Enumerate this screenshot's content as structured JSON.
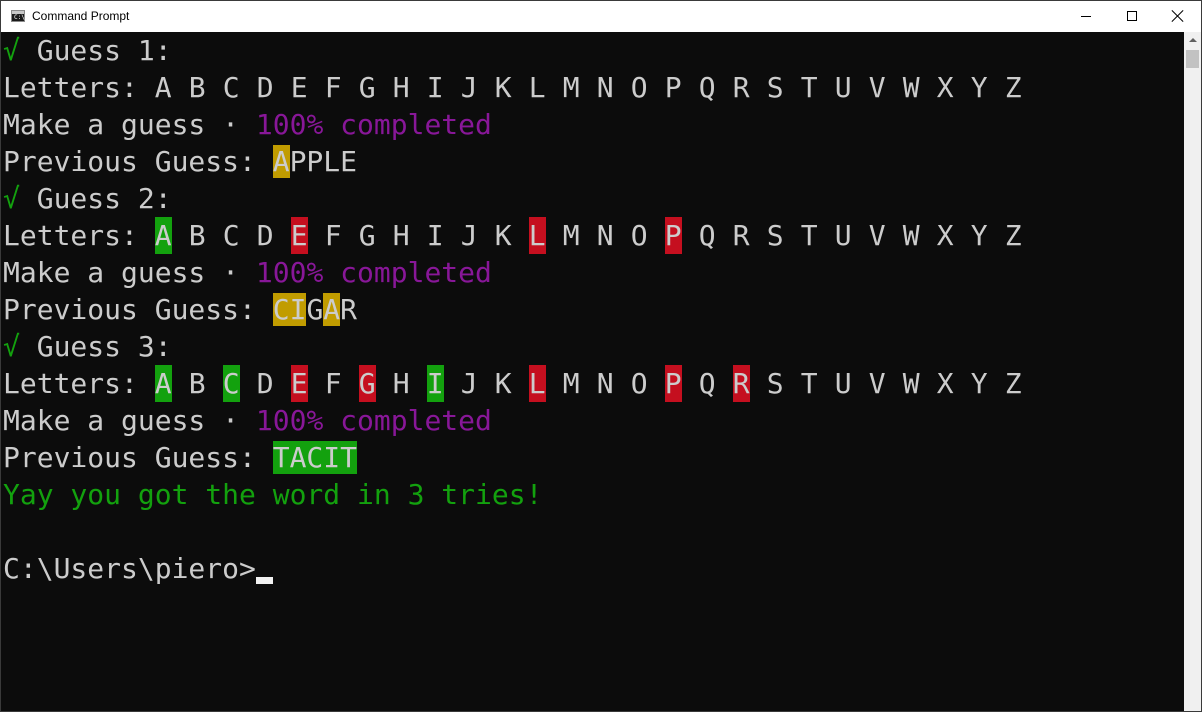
{
  "window": {
    "title": "Command Prompt",
    "app_icon_text": "C:\\"
  },
  "console": {
    "lines": [
      [
        {
          "t": "√",
          "c": "g"
        },
        {
          "t": " Guess 1:"
        }
      ],
      [
        {
          "t": "Letters: "
        },
        {
          "letters": [
            {
              "t": "A"
            },
            {
              "t": "B"
            },
            {
              "t": "C"
            },
            {
              "t": "D"
            },
            {
              "t": "E"
            },
            {
              "t": "F"
            },
            {
              "t": "G"
            },
            {
              "t": "H"
            },
            {
              "t": "I"
            },
            {
              "t": "J"
            },
            {
              "t": "K"
            },
            {
              "t": "L"
            },
            {
              "t": "M"
            },
            {
              "t": "N"
            },
            {
              "t": "O"
            },
            {
              "t": "P"
            },
            {
              "t": "Q"
            },
            {
              "t": "R"
            },
            {
              "t": "S"
            },
            {
              "t": "T"
            },
            {
              "t": "U"
            },
            {
              "t": "V"
            },
            {
              "t": "W"
            },
            {
              "t": "X"
            },
            {
              "t": "Y"
            },
            {
              "t": "Z"
            }
          ]
        }
      ],
      [
        {
          "t": "Make a guess · "
        },
        {
          "t": "100% completed",
          "c": "p"
        }
      ],
      [
        {
          "t": "Previous Guess: "
        },
        {
          "t": "A",
          "bg": "yellow"
        },
        {
          "t": "PPLE"
        }
      ],
      [
        {
          "t": "√",
          "c": "g"
        },
        {
          "t": " Guess 2:"
        }
      ],
      [
        {
          "t": "Letters: "
        },
        {
          "letters": [
            {
              "t": "A",
              "bg": "green"
            },
            {
              "t": "B"
            },
            {
              "t": "C"
            },
            {
              "t": "D"
            },
            {
              "t": "E",
              "bg": "red"
            },
            {
              "t": "F"
            },
            {
              "t": "G"
            },
            {
              "t": "H"
            },
            {
              "t": "I"
            },
            {
              "t": "J"
            },
            {
              "t": "K"
            },
            {
              "t": "L",
              "bg": "red"
            },
            {
              "t": "M"
            },
            {
              "t": "N"
            },
            {
              "t": "O"
            },
            {
              "t": "P",
              "bg": "red"
            },
            {
              "t": "Q"
            },
            {
              "t": "R"
            },
            {
              "t": "S"
            },
            {
              "t": "T"
            },
            {
              "t": "U"
            },
            {
              "t": "V"
            },
            {
              "t": "W"
            },
            {
              "t": "X"
            },
            {
              "t": "Y"
            },
            {
              "t": "Z"
            }
          ]
        }
      ],
      [
        {
          "t": "Make a guess · "
        },
        {
          "t": "100% completed",
          "c": "p"
        }
      ],
      [
        {
          "t": "Previous Guess: "
        },
        {
          "t": "CI",
          "bg": "yellow"
        },
        {
          "t": "G"
        },
        {
          "t": "A",
          "bg": "yellow"
        },
        {
          "t": "R"
        }
      ],
      [
        {
          "t": "√",
          "c": "g"
        },
        {
          "t": " Guess 3:"
        }
      ],
      [
        {
          "t": "Letters: "
        },
        {
          "letters": [
            {
              "t": "A",
              "bg": "green"
            },
            {
              "t": "B"
            },
            {
              "t": "C",
              "bg": "green"
            },
            {
              "t": "D"
            },
            {
              "t": "E",
              "bg": "red"
            },
            {
              "t": "F"
            },
            {
              "t": "G",
              "bg": "red"
            },
            {
              "t": "H"
            },
            {
              "t": "I",
              "bg": "green"
            },
            {
              "t": "J"
            },
            {
              "t": "K"
            },
            {
              "t": "L",
              "bg": "red"
            },
            {
              "t": "M"
            },
            {
              "t": "N"
            },
            {
              "t": "O"
            },
            {
              "t": "P",
              "bg": "red"
            },
            {
              "t": "Q"
            },
            {
              "t": "R",
              "bg": "red"
            },
            {
              "t": "S"
            },
            {
              "t": "T"
            },
            {
              "t": "U"
            },
            {
              "t": "V"
            },
            {
              "t": "W"
            },
            {
              "t": "X"
            },
            {
              "t": "Y"
            },
            {
              "t": "Z"
            }
          ]
        }
      ],
      [
        {
          "t": "Make a guess · "
        },
        {
          "t": "100% completed",
          "c": "p"
        }
      ],
      [
        {
          "t": "Previous Guess: "
        },
        {
          "t": "TACIT",
          "bg": "green"
        }
      ],
      [
        {
          "t": "Yay you got the word in 3 tries!",
          "c": "g"
        }
      ],
      [],
      [
        {
          "t": "C:\\Users\\piero>"
        },
        {
          "cursor": true
        }
      ]
    ]
  },
  "colors": {
    "background": "#0c0c0c",
    "text": "#cccccc",
    "green": "#13a10e",
    "red": "#c50f1f",
    "yellow": "#c19c00",
    "purple": "#881798"
  },
  "icons": {
    "minimize": "minimize-icon",
    "maximize": "maximize-icon",
    "close": "close-icon",
    "scroll_up": "arrow-up-icon"
  }
}
